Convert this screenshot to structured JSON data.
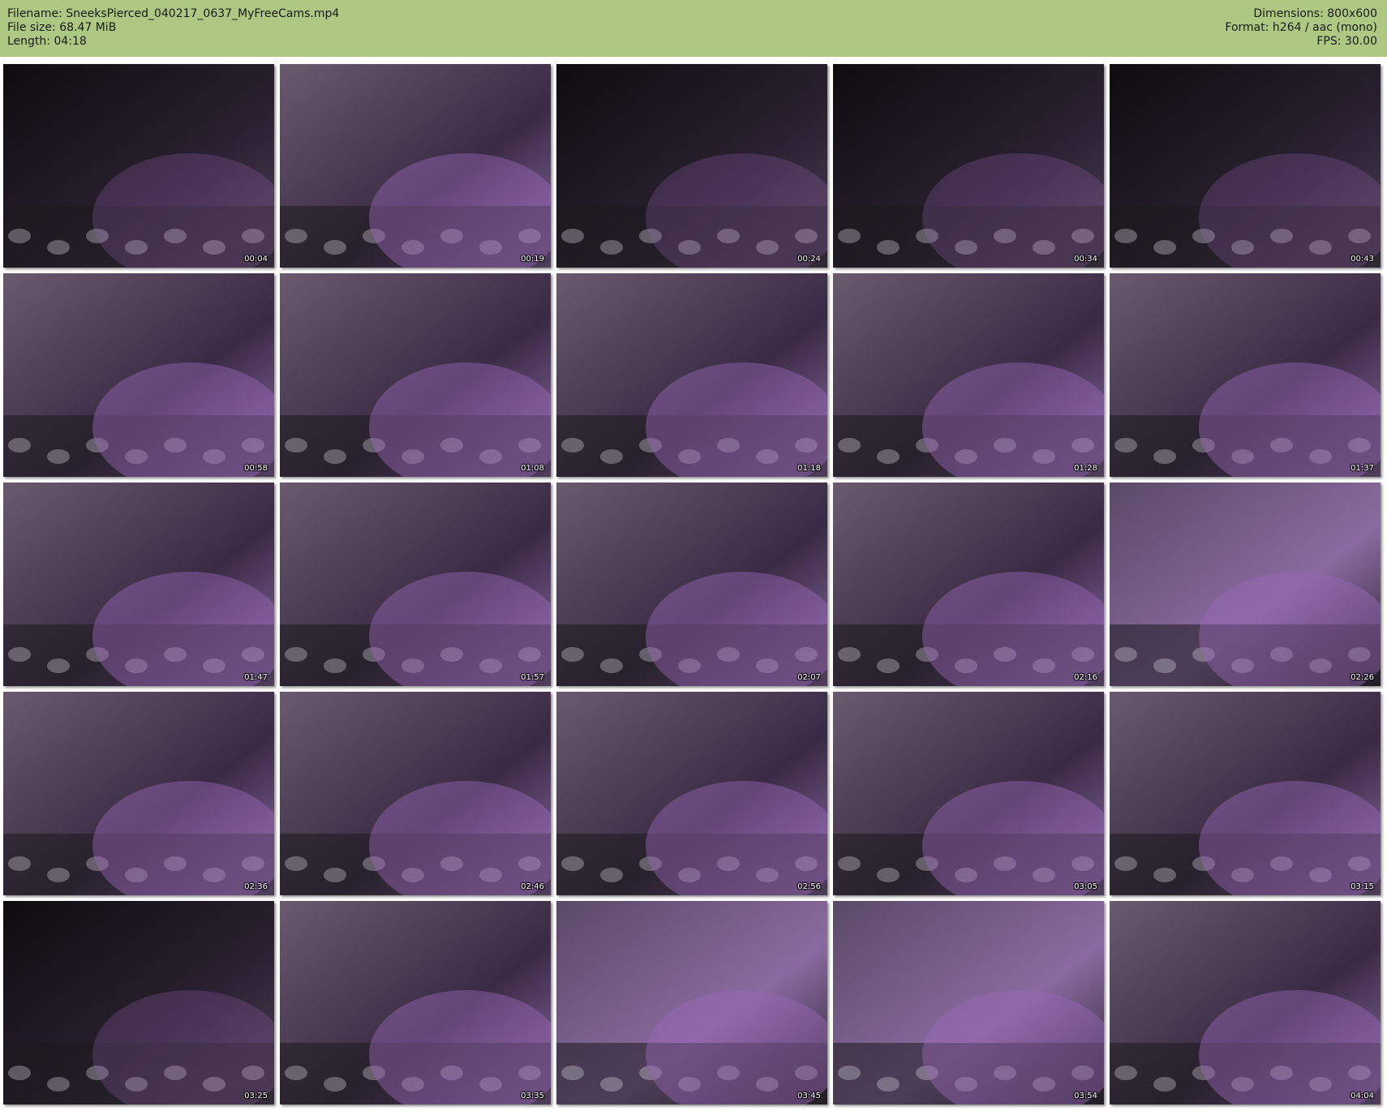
{
  "header": {
    "left": [
      "Filename: SneeksPierced_040217_0637_MyFreeCams.mp4",
      "File size: 68.47 MiB",
      "Length: 04:18"
    ],
    "right": [
      "Dimensions: 800x600",
      "Format: h264 / aac (mono)",
      "FPS: 30.00"
    ]
  },
  "colors": {
    "header_background": "#acc882",
    "page_background": "#ffffff",
    "timestamp_text": "#ffffff"
  },
  "thumbnails": [
    {
      "timestamp": "00:04",
      "scene": "dark"
    },
    {
      "timestamp": "00:19",
      "scene": "face"
    },
    {
      "timestamp": "00:24",
      "scene": "dark"
    },
    {
      "timestamp": "00:34",
      "scene": "dark"
    },
    {
      "timestamp": "00:43",
      "scene": "dark"
    },
    {
      "timestamp": "00:58",
      "scene": "face"
    },
    {
      "timestamp": "01:08",
      "scene": "face"
    },
    {
      "timestamp": "01:18",
      "scene": "face"
    },
    {
      "timestamp": "01:28",
      "scene": "face"
    },
    {
      "timestamp": "01:37",
      "scene": "face"
    },
    {
      "timestamp": "01:47",
      "scene": "face"
    },
    {
      "timestamp": "01:57",
      "scene": "face"
    },
    {
      "timestamp": "02:07",
      "scene": "face"
    },
    {
      "timestamp": "02:16",
      "scene": "face"
    },
    {
      "timestamp": "02:26",
      "scene": "blur"
    },
    {
      "timestamp": "02:36",
      "scene": "face"
    },
    {
      "timestamp": "02:46",
      "scene": "face"
    },
    {
      "timestamp": "02:56",
      "scene": "face"
    },
    {
      "timestamp": "03:05",
      "scene": "face"
    },
    {
      "timestamp": "03:15",
      "scene": "face"
    },
    {
      "timestamp": "03:25",
      "scene": "dark"
    },
    {
      "timestamp": "03:35",
      "scene": "face"
    },
    {
      "timestamp": "03:45",
      "scene": "blur"
    },
    {
      "timestamp": "03:54",
      "scene": "blur"
    },
    {
      "timestamp": "04:04",
      "scene": "face"
    }
  ]
}
